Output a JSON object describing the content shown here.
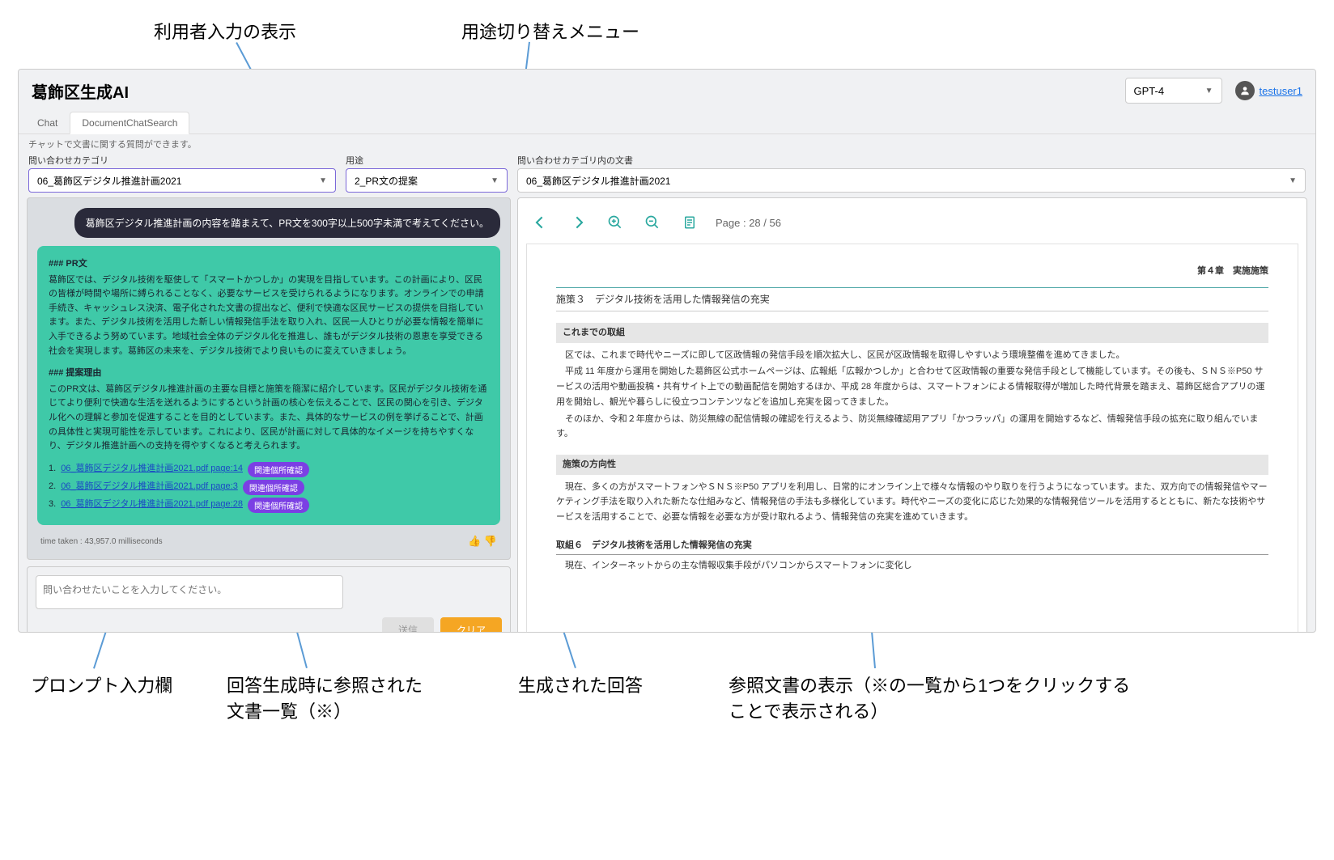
{
  "annotations": {
    "top1": "利用者入力の表示",
    "top2": "用途切り替えメニュー",
    "bottom1": "プロンプト入力欄",
    "bottom2": "回答生成時に参照された\n文書一覧（※）",
    "bottom3": "生成された回答",
    "bottom4": "参照文書の表示（※の一覧から1つをクリックすることで表示される）"
  },
  "app": {
    "title": "葛飾区生成AI",
    "model": "GPT-4",
    "username": "testuser1"
  },
  "tabs": {
    "chat": "Chat",
    "doc": "DocumentChatSearch"
  },
  "helper": "チャットで文書に関する質問ができます。",
  "controls": {
    "category_label": "問い合わせカテゴリ",
    "category_value": "06_葛飾区デジタル推進計画2021",
    "purpose_label": "用途",
    "purpose_value": "2_PR文の提案",
    "doc_label": "問い合わせカテゴリ内の文書",
    "doc_value": "06_葛飾区デジタル推進計画2021"
  },
  "chat": {
    "user": "葛飾区デジタル推進計画の内容を踏まえて、PR文を300字以上500字未満で考えてください。",
    "ai_h1": "### PR文",
    "ai_p1": "葛飾区では、デジタル技術を駆使して「スマートかつしか」の実現を目指しています。この計画により、区民の皆様が時間や場所に縛られることなく、必要なサービスを受けられるようになります。オンラインでの申請手続き、キャッシュレス決済、電子化された文書の提出など、便利で快適な区民サービスの提供を目指しています。また、デジタル技術を活用した新しい情報発信手法を取り入れ、区民一人ひとりが必要な情報を簡単に入手できるよう努めています。地域社会全体のデジタル化を推進し、誰もがデジタル技術の恩恵を享受できる社会を実現します。葛飾区の未来を、デジタル技術でより良いものに変えていきましょう。",
    "ai_h2": "### 提案理由",
    "ai_p2": "このPR文は、葛飾区デジタル推進計画の主要な目標と施策を簡潔に紹介しています。区民がデジタル技術を通じてより便利で快適な生活を送れるようにするという計画の核心を伝えることで、区民の関心を引き、デジタル化への理解と参加を促進することを目的としています。また、具体的なサービスの例を挙げることで、計画の具体性と実現可能性を示しています。これにより、区民が計画に対して具体的なイメージを持ちやすくなり、デジタル推進計画への支持を得やすくなると考えられます。",
    "refs": [
      {
        "n": "1.",
        "link": "06_葛飾区デジタル推進計画2021.pdf page:14",
        "btn": "関連個所確認"
      },
      {
        "n": "2.",
        "link": "06_葛飾区デジタル推進計画2021.pdf page:3",
        "btn": "関連個所確認"
      },
      {
        "n": "3.",
        "link": "06_葛飾区デジタル推進計画2021.pdf page:28",
        "btn": "関連個所確認"
      }
    ],
    "time": "time taken : 43,957.0 milliseconds"
  },
  "input": {
    "placeholder": "問い合わせたいことを入力してください。",
    "send": "送信",
    "clear": "クリア"
  },
  "pdf": {
    "page_info": "Page : 28 / 56",
    "chapter": "第４章　実施施策",
    "section": "施策３　デジタル技術を活用した情報発信の充実",
    "sub1": "これまでの取組",
    "para1a": "区では、これまで時代やニーズに即して区政情報の発信手段を順次拡大し、区民が区政情報を取得しやすいよう環境整備を進めてきました。",
    "para1b": "平成 11 年度から運用を開始した葛飾区公式ホームページは、広報紙「広報かつしか」と合わせて区政情報の重要な発信手段として機能しています。その後も、ＳＮＳ※P50 サービスの活用や動画投稿・共有サイト上での動画配信を開始するほか、平成 28 年度からは、スマートフォンによる情報取得が増加した時代背景を踏まえ、葛飾区総合アプリの運用を開始し、観光や暮らしに役立つコンテンツなどを追加し充実を図ってきました。",
    "para1c": "そのほか、令和２年度からは、防災無線の配信情報の確認を行えるよう、防災無線確認用アプリ「かつラッパ」の運用を開始するなど、情報発信手段の拡充に取り組んでいます。",
    "sub2": "施策の方向性",
    "para2a": "現在、多くの方がスマートフォンやＳＮＳ※P50 アプリを利用し、日常的にオンライン上で様々な情報のやり取りを行うようになっています。また、双方向での情報発信やマーケティング手法を取り入れた新たな仕組みなど、情報発信の手法も多様化しています。時代やニーズの変化に応じた効果的な情報発信ツールを活用するとともに、新たな技術やサービスを活用することで、必要な情報を必要な方が受け取れるよう、情報発信の充実を進めていきます。",
    "item_title": "取組６　デジタル技術を活用した情報発信の充実",
    "item_body": "現在、インターネットからの主な情報収集手段がパソコンからスマートフォンに変化し"
  }
}
